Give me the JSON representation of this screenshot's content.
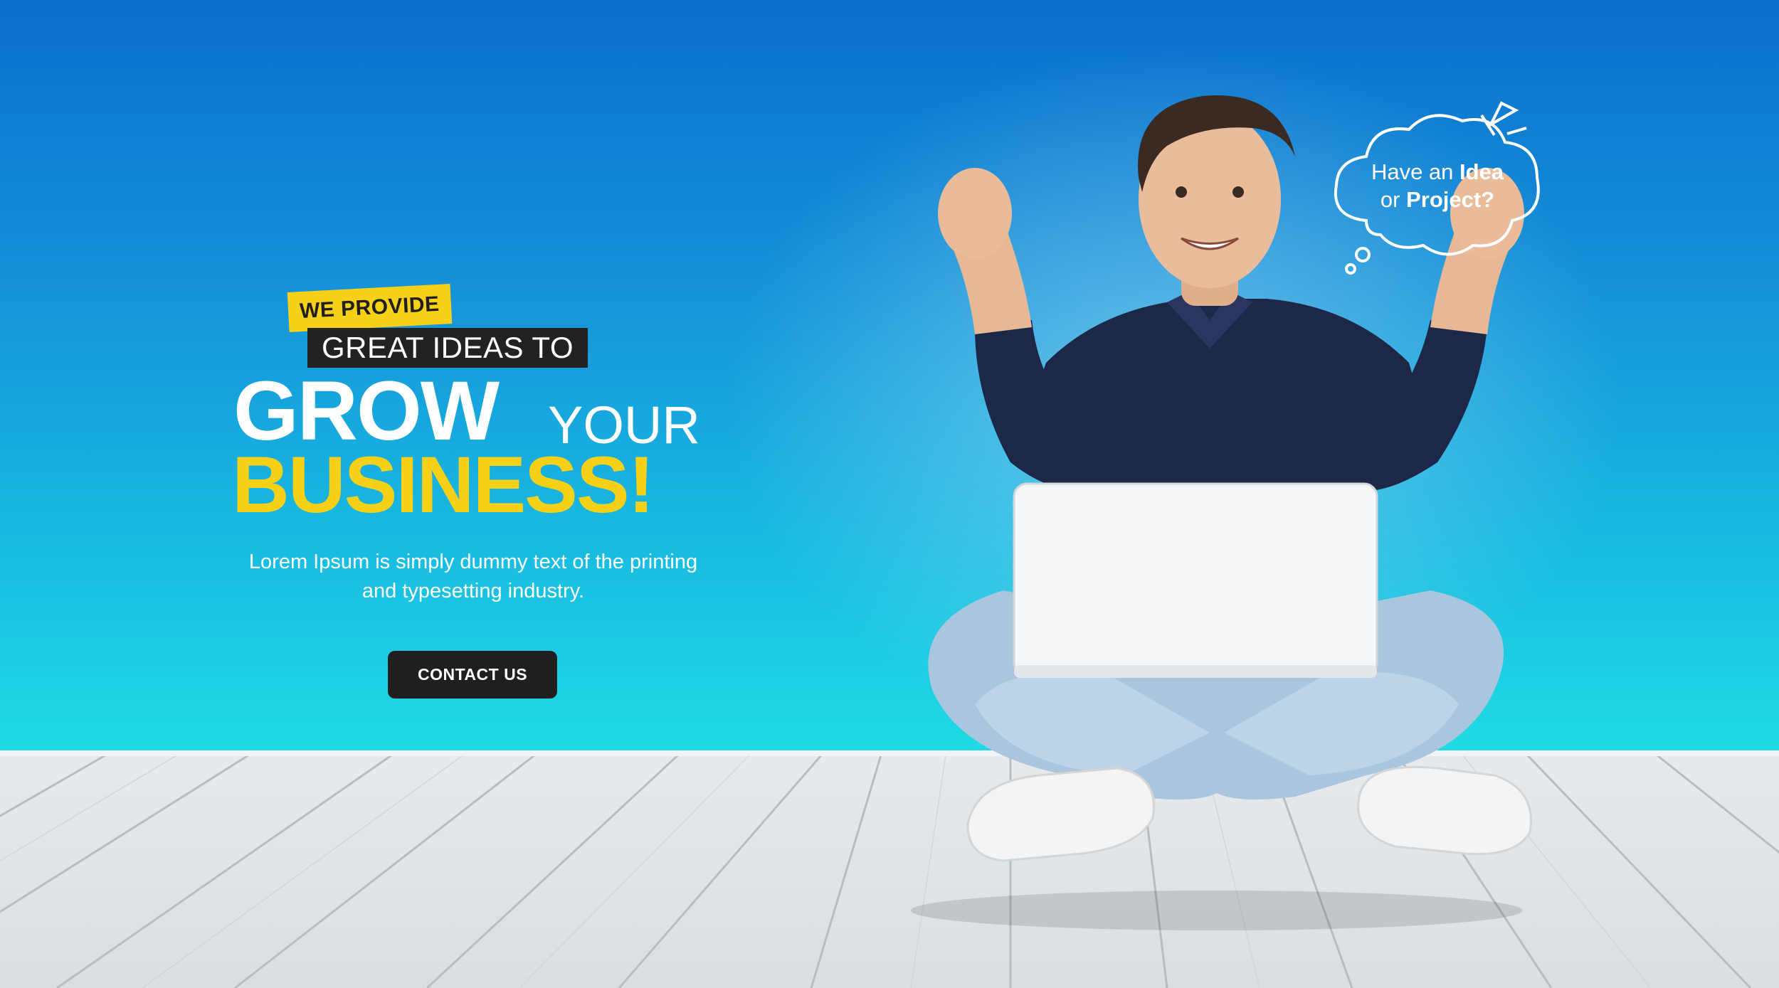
{
  "hero": {
    "tag_top": "WE PROVIDE",
    "tag_sub": "GREAT IDEAS TO",
    "headline_word1": "GROW",
    "headline_word2": "YOUR",
    "headline_word3": "BUSINESS!",
    "description": "Lorem Ipsum is simply dummy text of the printing and typesetting industry.",
    "cta_label": "CONTACT US"
  },
  "bubble": {
    "line1_prefix": "Have an ",
    "line1_bold": "Idea",
    "line2_prefix": "or ",
    "line2_bold": "Project?"
  },
  "colors": {
    "sky_top": "#0b6fcc",
    "sky_bottom": "#1fdbe4",
    "accent_yellow": "#f7d117",
    "dark": "#1f1f1f",
    "floor": "#e2e6e9"
  },
  "icons": [
    "thought-bubble-icon",
    "sparkle-icon"
  ]
}
